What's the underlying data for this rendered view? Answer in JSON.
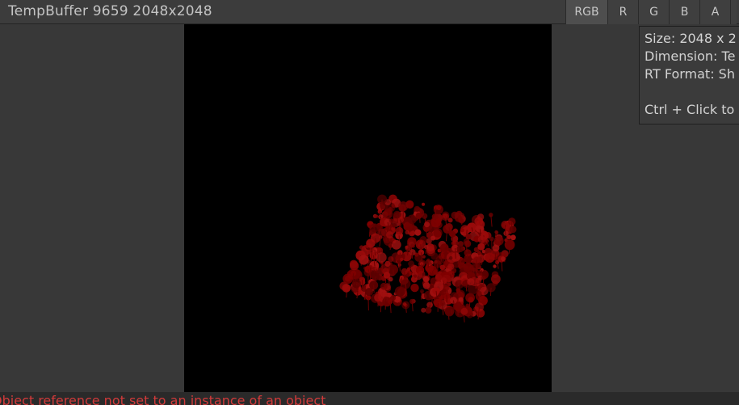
{
  "header": {
    "title": "TempBuffer 9659 2048x2048",
    "channels": [
      "RGB",
      "R",
      "G",
      "B",
      "A"
    ]
  },
  "tooltip": {
    "size_line": "Size: 2048 x 2",
    "dimension_line": "Dimension: Te",
    "format_line": "RT Format: Sh",
    "hint_line": "Ctrl + Click to"
  },
  "console": {
    "message": "Object reference not set to an instance of an object"
  },
  "colors": {
    "panel": "#383838",
    "header": "#3c3c3c",
    "preview_bg": "#000000",
    "foliage": "#8b0000",
    "error_text": "#d23a3a"
  }
}
